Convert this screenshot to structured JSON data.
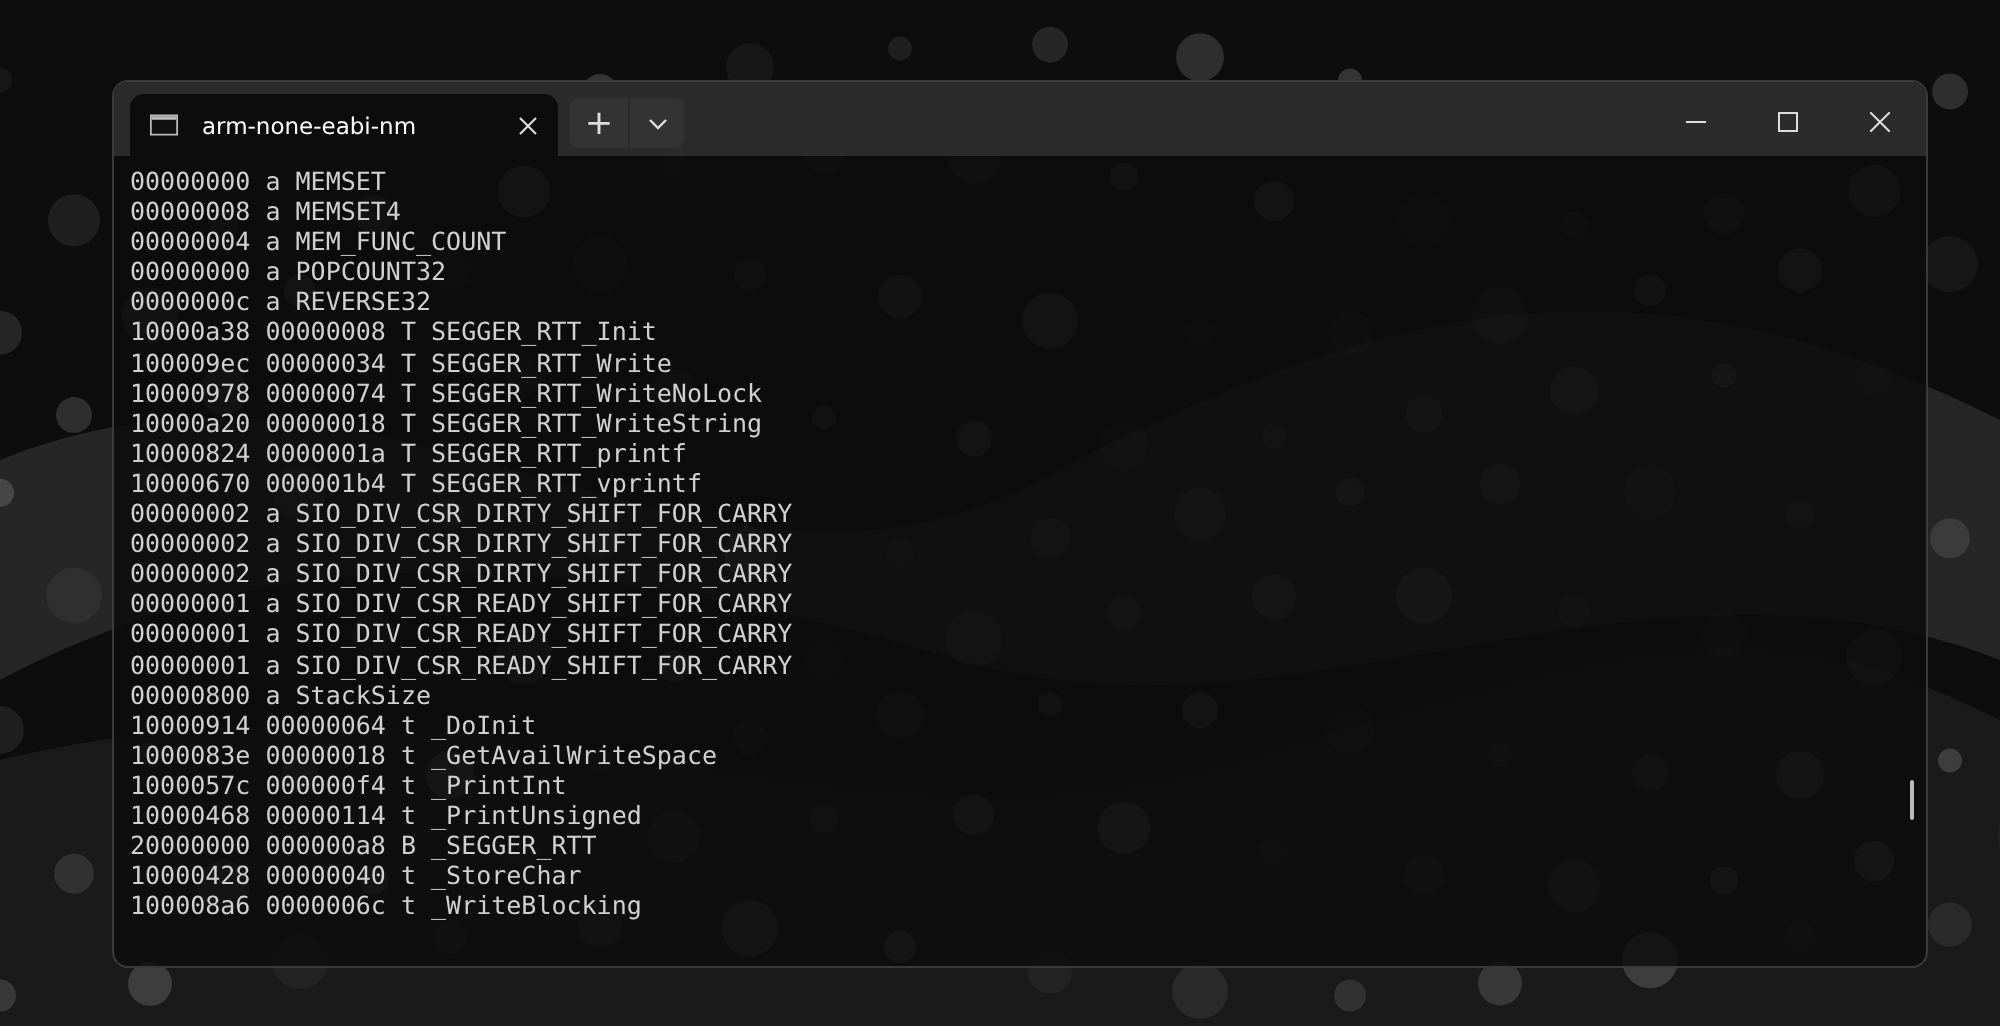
{
  "tabs": [
    {
      "label": "arm-none-eabi-nm",
      "selected": true
    }
  ],
  "new_tab_button": "+",
  "terminal_lines": [
    "00000000 a MEMSET",
    "00000008 a MEMSET4",
    "00000004 a MEM_FUNC_COUNT",
    "00000000 a POPCOUNT32",
    "0000000c a REVERSE32",
    "10000a38 00000008 T SEGGER_RTT_Init",
    "100009ec 00000034 T SEGGER_RTT_Write",
    "10000978 00000074 T SEGGER_RTT_WriteNoLock",
    "10000a20 00000018 T SEGGER_RTT_WriteString",
    "10000824 0000001a T SEGGER_RTT_printf",
    "10000670 000001b4 T SEGGER_RTT_vprintf",
    "00000002 a SIO_DIV_CSR_DIRTY_SHIFT_FOR_CARRY",
    "00000002 a SIO_DIV_CSR_DIRTY_SHIFT_FOR_CARRY",
    "00000002 a SIO_DIV_CSR_DIRTY_SHIFT_FOR_CARRY",
    "00000001 a SIO_DIV_CSR_READY_SHIFT_FOR_CARRY",
    "00000001 a SIO_DIV_CSR_READY_SHIFT_FOR_CARRY",
    "00000001 a SIO_DIV_CSR_READY_SHIFT_FOR_CARRY",
    "00000800 a StackSize",
    "10000914 00000064 t _DoInit",
    "1000083e 00000018 t _GetAvailWriteSpace",
    "1000057c 000000f4 t _PrintInt",
    "10000468 00000114 t _PrintUnsigned",
    "20000000 000000a8 B _SEGGER_RTT",
    "10000428 00000040 t _StoreChar",
    "100008a6 0000006c t _WriteBlocking"
  ]
}
